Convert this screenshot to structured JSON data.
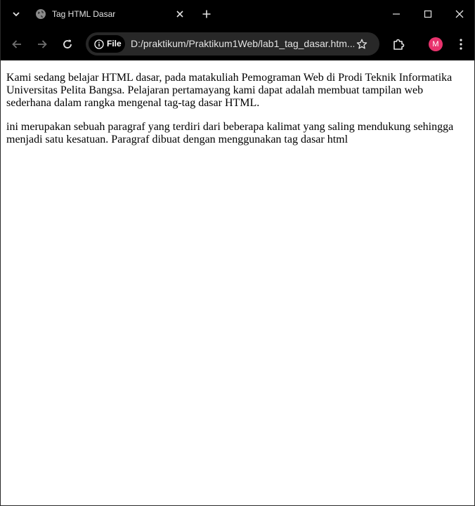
{
  "browser": {
    "tab": {
      "title": "Tag HTML Dasar"
    },
    "omnibox": {
      "site_chip_label": "File",
      "url": "D:/praktikum/Praktikum1Web/lab1_tag_dasar.htm..."
    },
    "profile": {
      "initial": "M",
      "color": "#e8336d"
    },
    "icons": {
      "tab_search": "chevron-down-icon",
      "favicon": "globe-icon",
      "tab_close": "close-icon",
      "new_tab": "plus-icon",
      "minimize": "minimize-icon",
      "maximize": "maximize-icon",
      "close_window": "close-icon",
      "back": "arrow-left-icon",
      "forward": "arrow-right-icon",
      "reload": "reload-icon",
      "site_info": "info-icon",
      "bookmark": "star-icon",
      "extensions": "puzzle-icon",
      "menu": "kebab-menu-icon"
    }
  },
  "page": {
    "paragraphs": [
      "Kami sedang belajar HTML dasar, pada matakuliah Pemograman Web di Prodi Teknik Informatika Universitas Pelita Bangsa. Pelajaran pertamayang kami dapat adalah membuat tampilan web sederhana dalam rangka mengenal tag-tag dasar HTML.",
      "ini merupakan sebuah paragraf yang terdiri dari beberapa kalimat yang saling mendukung sehingga menjadi satu kesatuan. Paragraf dibuat dengan menggunakan tag dasar html"
    ]
  }
}
